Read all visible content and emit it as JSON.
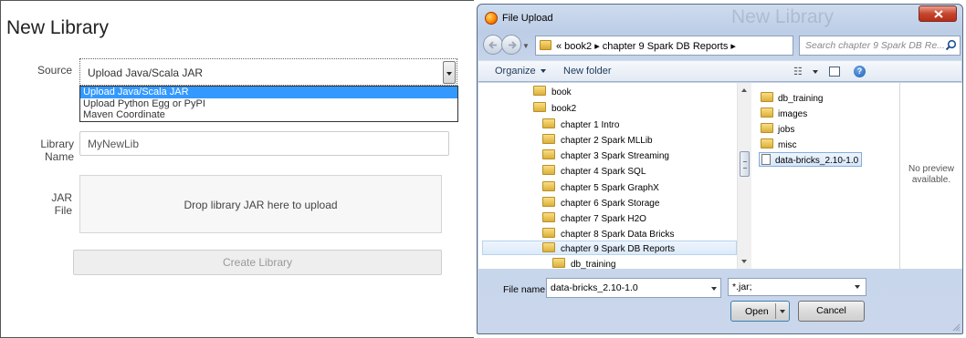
{
  "library_form": {
    "title": "New Library",
    "source_label": "Source",
    "source_value": "Upload Java/Scala JAR",
    "source_options": [
      "Upload Java/Scala JAR",
      "Upload Python Egg or PyPI",
      "Maven Coordinate"
    ],
    "library_name_label": "Library Name",
    "library_name_value": "MyNewLib",
    "jar_file_label": "JAR File",
    "dropzone_text": "Drop library JAR here to upload",
    "create_button": "Create Library"
  },
  "dialog": {
    "title": "File Upload",
    "background_title": "New Library",
    "address_path": "« book2 ▸ chapter 9 Spark DB Reports ▸",
    "search_placeholder": "Search chapter 9 Spark DB Re...",
    "toolbar": {
      "organize": "Organize",
      "new_folder": "New folder"
    },
    "tree": [
      {
        "label": "book",
        "indent": 0,
        "selected": false
      },
      {
        "label": "book2",
        "indent": 0,
        "selected": false
      },
      {
        "label": "chapter 1 Intro",
        "indent": 1,
        "selected": false
      },
      {
        "label": "chapter 2 Spark MLLib",
        "indent": 1,
        "selected": false
      },
      {
        "label": "chapter 3 Spark Streaming",
        "indent": 1,
        "selected": false
      },
      {
        "label": "chapter 4 Spark SQL",
        "indent": 1,
        "selected": false
      },
      {
        "label": "chapter 5 Spark GraphX",
        "indent": 1,
        "selected": false
      },
      {
        "label": "chapter 6 Spark Storage",
        "indent": 1,
        "selected": false
      },
      {
        "label": "chapter 7 Spark H2O",
        "indent": 1,
        "selected": false
      },
      {
        "label": "chapter 8 Spark Data Bricks",
        "indent": 1,
        "selected": false
      },
      {
        "label": "chapter 9 Spark DB Reports",
        "indent": 1,
        "selected": true
      },
      {
        "label": "db_training",
        "indent": 2,
        "selected": false
      }
    ],
    "files": [
      {
        "label": "db_training",
        "type": "folder",
        "selected": false
      },
      {
        "label": "images",
        "type": "folder",
        "selected": false
      },
      {
        "label": "jobs",
        "type": "folder",
        "selected": false
      },
      {
        "label": "misc",
        "type": "folder",
        "selected": false
      },
      {
        "label": "data-bricks_2.10-1.0",
        "type": "file",
        "selected": true
      }
    ],
    "preview_text": "No preview available.",
    "file_name_label": "File name:",
    "file_name_value": "data-bricks_2.10-1.0",
    "filter_value": "*.jar;",
    "open_button": "Open",
    "cancel_button": "Cancel"
  },
  "colors": {
    "highlight": "#3399ff",
    "dialog_frame": "#c6d4ea",
    "close_button": "#c7462d"
  }
}
